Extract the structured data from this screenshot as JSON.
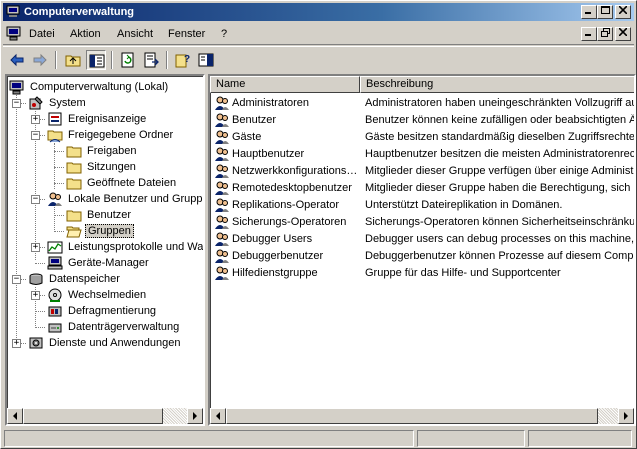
{
  "window": {
    "title": "Computerverwaltung"
  },
  "menu": {
    "items": [
      "Datei",
      "Aktion",
      "Ansicht",
      "Fenster",
      "?"
    ]
  },
  "toolbar": {
    "icons": [
      "back-arrow-icon",
      "forward-arrow-icon",
      "up-folder-icon",
      "show-hide-tree-icon",
      "refresh-icon",
      "export-list-icon",
      "help-icon",
      "console-tree-icon"
    ]
  },
  "tree": {
    "root": "Computerverwaltung (Lokal)",
    "system": "System",
    "ereignisanzeige": "Ereignisanzeige",
    "freigegebene_ordner": "Freigegebene Ordner",
    "freigaben": "Freigaben",
    "sitzungen": "Sitzungen",
    "geoeffnete_dateien": "Geöffnete Dateien",
    "lokale_benutzer": "Lokale Benutzer und Gruppe",
    "benutzer": "Benutzer",
    "gruppen": "Gruppen",
    "leistungsprotokolle": "Leistungsprotokolle und War",
    "geraete_manager": "Geräte-Manager",
    "datenspeicher": "Datenspeicher",
    "wechselmedien": "Wechselmedien",
    "defragmentierung": "Defragmentierung",
    "datentraegerverwaltung": "Datenträgerverwaltung",
    "dienste": "Dienste und Anwendungen"
  },
  "list": {
    "columns": [
      "Name",
      "Beschreibung"
    ],
    "rows": [
      {
        "name": "Administratoren",
        "description": "Administratoren haben uneingeschränkten Vollzugriff au"
      },
      {
        "name": "Benutzer",
        "description": "Benutzer können keine zufälligen oder beabsichtigten Är"
      },
      {
        "name": "Gäste",
        "description": "Gäste besitzen standardmäßig dieselben Zugriffsrechte"
      },
      {
        "name": "Hauptbenutzer",
        "description": "Hauptbenutzer besitzen die meisten Administratorenrecl"
      },
      {
        "name": "Netzwerkkonfigurations…",
        "description": "Mitglieder dieser Gruppe verfügen über einige Administr."
      },
      {
        "name": "Remotedesktopbenutzer",
        "description": "Mitglieder dieser Gruppe haben die Berechtigung, sich re"
      },
      {
        "name": "Replikations-Operator",
        "description": "Unterstützt Dateireplikation in Domänen."
      },
      {
        "name": "Sicherungs-Operatoren",
        "description": "Sicherungs-Operatoren können Sicherheitseinschränkun"
      },
      {
        "name": "Debugger Users",
        "description": "Debugger users can debug processes on this machine, b"
      },
      {
        "name": "Debuggerbenutzer",
        "description": "Debuggerbenutzer können Prozesse auf diesem Comput"
      },
      {
        "name": "Hilfedienstgruppe",
        "description": "Gruppe für das Hilfe- und Supportcenter"
      }
    ]
  },
  "colors": {
    "title_gradient_start": "#0a246a",
    "title_gradient_end": "#a6caf0",
    "face": "#d4d0c8"
  }
}
